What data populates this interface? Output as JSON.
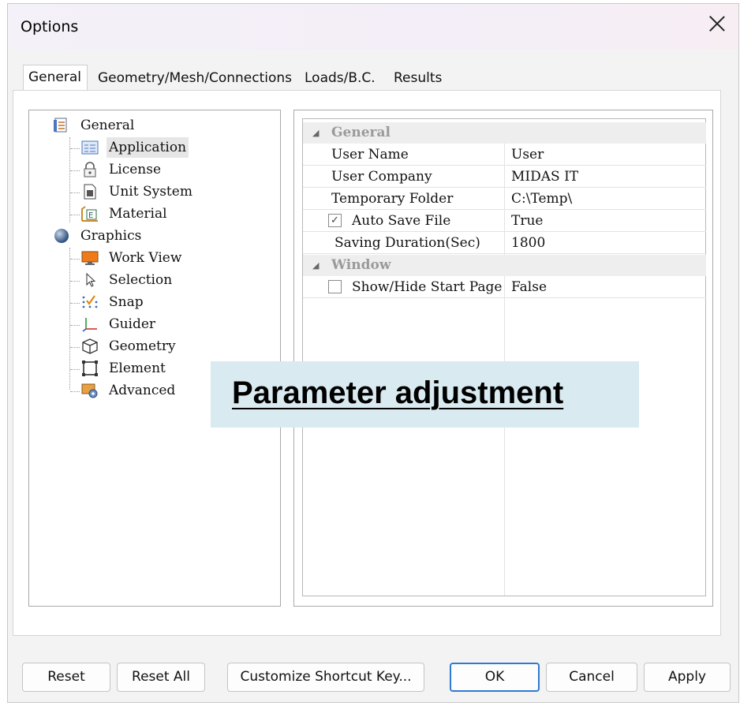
{
  "window": {
    "title": "Options"
  },
  "tabs": [
    "General",
    "Geometry/Mesh/Connections",
    "Loads/B.C.",
    "Results"
  ],
  "tree": [
    {
      "label": "General",
      "icon": "document-list-icon",
      "level": 0
    },
    {
      "label": "Application",
      "icon": "application-icon",
      "level": 1,
      "selected": true
    },
    {
      "label": "License",
      "icon": "lock-icon",
      "level": 1
    },
    {
      "label": "Unit System",
      "icon": "unit-document-icon",
      "level": 1
    },
    {
      "label": "Material",
      "icon": "material-icon",
      "level": 1
    },
    {
      "label": "Graphics",
      "icon": "sphere-icon",
      "level": 0
    },
    {
      "label": "Work View",
      "icon": "monitor-icon",
      "level": 1
    },
    {
      "label": "Selection",
      "icon": "cursor-icon",
      "level": 1
    },
    {
      "label": "Snap",
      "icon": "snap-icon",
      "level": 1
    },
    {
      "label": "Guider",
      "icon": "axes-icon",
      "level": 1
    },
    {
      "label": "Geometry",
      "icon": "cube-icon",
      "level": 1
    },
    {
      "label": "Element",
      "icon": "element-icon",
      "level": 1
    },
    {
      "label": "Advanced",
      "icon": "advanced-gear-icon",
      "level": 1
    }
  ],
  "properties": {
    "categories": [
      {
        "name": "General",
        "rows": [
          {
            "name": "User Name",
            "value": "User"
          },
          {
            "name": "User Company",
            "value": "MIDAS IT"
          },
          {
            "name": "Temporary Folder",
            "value": "C:\\Temp\\"
          },
          {
            "name": "Auto Save File",
            "value": "True",
            "checkbox": true,
            "checked": true
          },
          {
            "name": "Saving Duration(Sec)",
            "value": "1800"
          }
        ]
      },
      {
        "name": "Window",
        "rows": [
          {
            "name": "Show/Hide Start Page",
            "value": "False",
            "checkbox": true,
            "checked": false
          }
        ]
      }
    ]
  },
  "overlay": {
    "text": "Parameter adjustment"
  },
  "buttons": {
    "reset": "Reset",
    "reset_all": "Reset All",
    "shortcut": "Customize Shortcut Key...",
    "ok": "OK",
    "cancel": "Cancel",
    "apply": "Apply"
  }
}
